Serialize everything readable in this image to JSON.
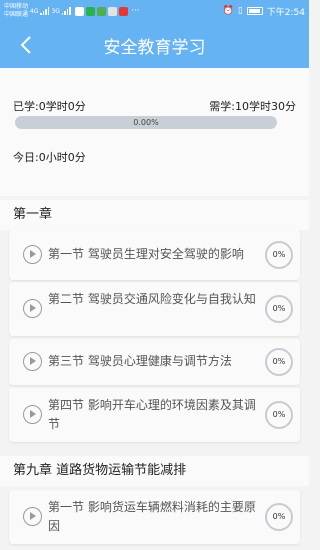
{
  "status_bar": {
    "carrier1": "中国移动",
    "carrier2": "中国联通",
    "net1": "4G",
    "net2": "3G",
    "more": "···",
    "time": "下午2:54"
  },
  "header": {
    "title": "安全教育学习",
    "back_icon": "chevron-left-icon"
  },
  "summary": {
    "learned": "已学:0学时0分",
    "required": "需学:10学时30分",
    "progress_text": "0.00%",
    "progress_value": 0,
    "today": "今日:0小时0分"
  },
  "chapters": [
    {
      "title": "第一章",
      "lessons": [
        {
          "title": "第一节 驾驶员生理对安全驾驶的影响",
          "percent": "0%"
        },
        {
          "title": "第二节 驾驶员交通风险变化与自我认知",
          "percent": "0%"
        },
        {
          "title": "第三节 驾驶员心理健康与调节方法",
          "percent": "0%"
        },
        {
          "title": "第四节 影响开车心理的环境因素及其调节",
          "percent": "0%"
        }
      ]
    },
    {
      "title": "第九章 道路货物运输节能减排",
      "lessons": [
        {
          "title": "第一节 影响货运车辆燃料消耗的主要原因",
          "percent": "0%"
        }
      ]
    }
  ],
  "colors": {
    "primary": "#65b3f3",
    "track": "#c9cfd6"
  }
}
